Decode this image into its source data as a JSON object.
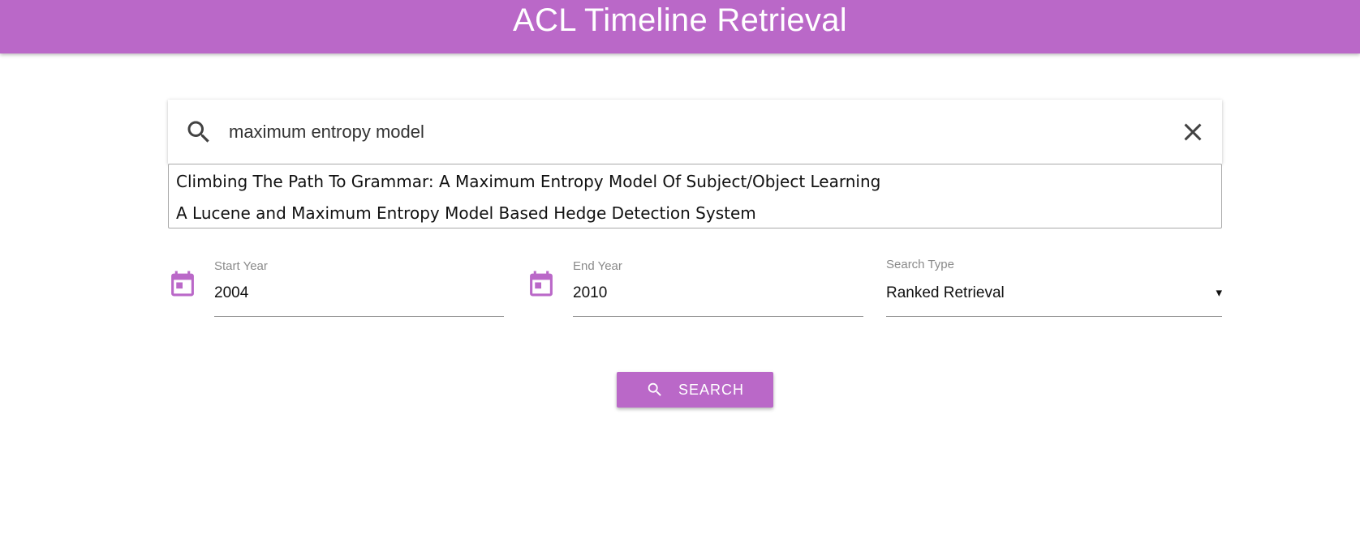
{
  "header": {
    "title": "ACL Timeline Retrieval"
  },
  "search": {
    "query": "maximum entropy model",
    "icon": "search-icon",
    "clear_icon": "close-icon"
  },
  "suggestions": [
    "Climbing The Path To Grammar: A Maximum Entropy Model Of Subject/Object Learning",
    "A Lucene and Maximum Entropy Model Based Hedge Detection System"
  ],
  "filters": {
    "start_year": {
      "label": "Start Year",
      "value": "2004",
      "icon": "calendar-icon"
    },
    "end_year": {
      "label": "End Year",
      "value": "2010",
      "icon": "calendar-icon"
    },
    "search_type": {
      "label": "Search Type",
      "value": "Ranked Retrieval",
      "arrow": "▾"
    }
  },
  "actions": {
    "search_label": "SEARCH"
  },
  "colors": {
    "accent": "#ba68c8",
    "icon_dark": "#424242"
  }
}
